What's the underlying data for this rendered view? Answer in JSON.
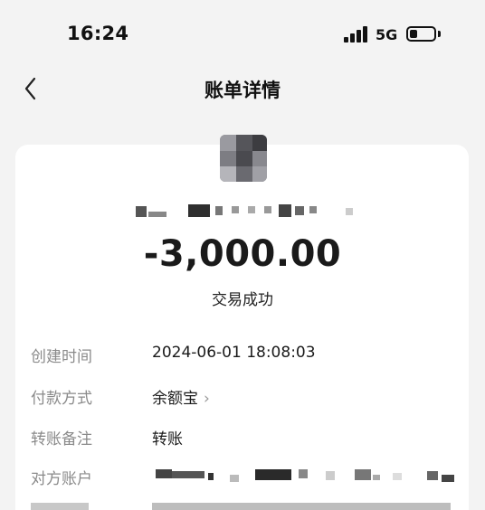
{
  "status_bar": {
    "time": "16:24",
    "network": "5G",
    "battery_level": 0.3
  },
  "nav": {
    "back_icon": "chevron-left-icon",
    "title": "账单详情"
  },
  "transaction": {
    "amount": "-3,000.00",
    "status": "交易成功",
    "details": [
      {
        "label": "创建时间",
        "value": "2024-06-01 18:08:03"
      },
      {
        "label": "付款方式",
        "value": "余额宝",
        "chevron": "›"
      },
      {
        "label": "转账备注",
        "value": "转账"
      },
      {
        "label": "对方账户",
        "value": ""
      }
    ]
  },
  "colors": {
    "background": "#f3f3f3",
    "card": "#ffffff",
    "label": "#8a8a8a",
    "text": "#1a1a1a"
  }
}
